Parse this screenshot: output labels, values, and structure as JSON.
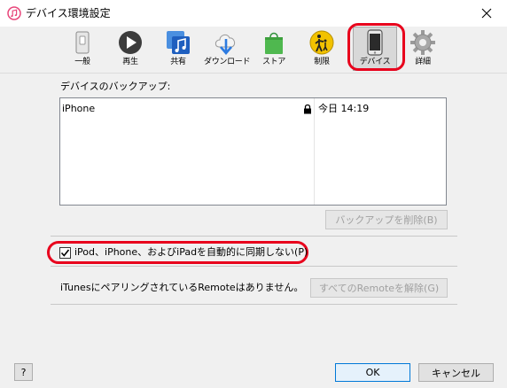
{
  "window": {
    "title": "デバイス環境設定",
    "close_glyph": "✕"
  },
  "toolbar": {
    "tabs": [
      {
        "label": "一般",
        "icon": "general-switch-icon"
      },
      {
        "label": "再生",
        "icon": "play-icon"
      },
      {
        "label": "共有",
        "icon": "music-sharing-icon"
      },
      {
        "label": "ダウンロード",
        "icon": "cloud-download-icon"
      },
      {
        "label": "ストア",
        "icon": "shopping-bag-icon"
      },
      {
        "label": "制限",
        "icon": "parental-restriction-icon"
      },
      {
        "label": "デバイス",
        "icon": "iphone-icon",
        "selected": true
      },
      {
        "label": "詳細",
        "icon": "gear-icon"
      }
    ]
  },
  "backups": {
    "label": "デバイスのバックアップ:",
    "rows": [
      {
        "name": "iPhone",
        "locked": true,
        "date": "今日 14:19"
      }
    ],
    "delete_button": "バックアップを削除(B)"
  },
  "sync": {
    "checked": true,
    "label": "iPod、iPhone、およびiPadを自動的に同期しない(P)"
  },
  "remote": {
    "text": "iTunesにペアリングされているRemoteはありません。",
    "remove_button": "すべてのRemoteを解除(G)"
  },
  "footer": {
    "help": "?",
    "ok": "OK",
    "cancel": "キャンセル"
  },
  "colors": {
    "highlight": "#e8001c",
    "ok_border": "#0078d7"
  }
}
